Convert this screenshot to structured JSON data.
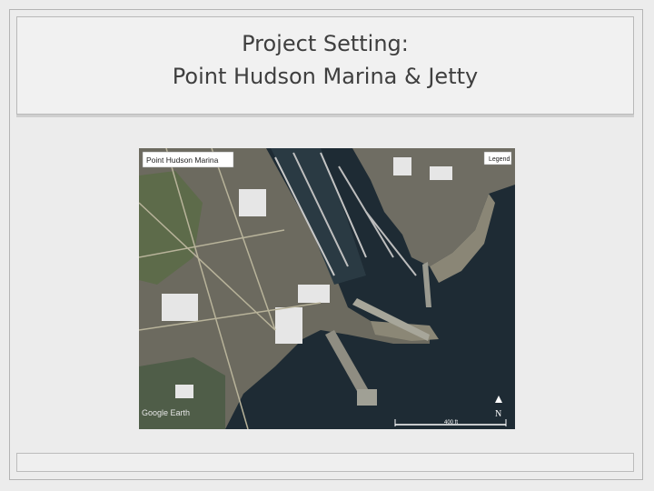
{
  "slide": {
    "title_line1": "Project Setting:",
    "title_line2": "Point Hudson Marina & Jetty"
  },
  "map": {
    "place_label": "Point Hudson Marina",
    "legend_label": "Legend",
    "north_label": "N",
    "scale_label": "400 ft",
    "attribution": "Google Earth",
    "water_color": "#1d2a33",
    "land_color": "#6b6a5e"
  }
}
